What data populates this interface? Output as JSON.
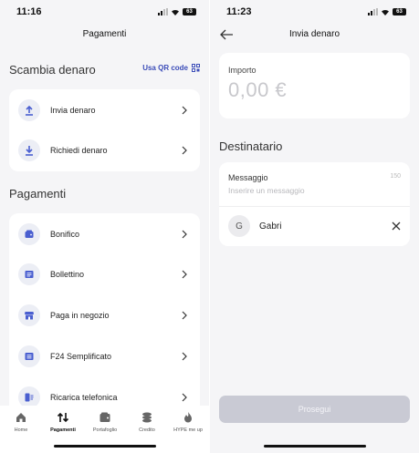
{
  "left": {
    "status": {
      "time": "11:16",
      "battery": "63"
    },
    "title": "Pagamenti",
    "exchange": {
      "heading": "Scambia denaro",
      "qr_label": "Usa QR code",
      "items": [
        {
          "label": "Invia denaro",
          "icon": "upload-icon"
        },
        {
          "label": "Richiedi denaro",
          "icon": "download-icon"
        }
      ]
    },
    "payments": {
      "heading": "Pagamenti",
      "items": [
        {
          "label": "Bonifico",
          "icon": "wallet-icon"
        },
        {
          "label": "Bollettino",
          "icon": "document-icon"
        },
        {
          "label": "Paga in negozio",
          "icon": "store-icon"
        },
        {
          "label": "F24 Semplificato",
          "icon": "form-icon"
        },
        {
          "label": "Ricarica telefonica",
          "icon": "phone-topup-icon"
        }
      ]
    },
    "tabbar": [
      {
        "label": "Home",
        "icon": "home-icon",
        "active": false
      },
      {
        "label": "Pagamenti",
        "icon": "transfer-arrows-icon",
        "active": true
      },
      {
        "label": "Portafoglio",
        "icon": "wallet-icon",
        "active": false
      },
      {
        "label": "Credito",
        "icon": "coins-icon",
        "active": false
      },
      {
        "label": "HYPE me up",
        "icon": "flame-icon",
        "active": false
      }
    ]
  },
  "right": {
    "status": {
      "time": "11:23",
      "battery": "63"
    },
    "title": "Invia denaro",
    "amount": {
      "label": "Importo",
      "value": "0,00 €"
    },
    "recipient": {
      "heading": "Destinatario",
      "message_label": "Messaggio",
      "message_counter": "150",
      "message_placeholder": "Inserire un messaggio",
      "contact_initial": "G",
      "contact_name": "Gabri"
    },
    "proceed_label": "Prosegui"
  },
  "colors": {
    "accent": "#3b4cb8",
    "icon_blue": "#4a5fd0",
    "disabled_button": "#c9cad4",
    "background": "#f5f5f7"
  }
}
